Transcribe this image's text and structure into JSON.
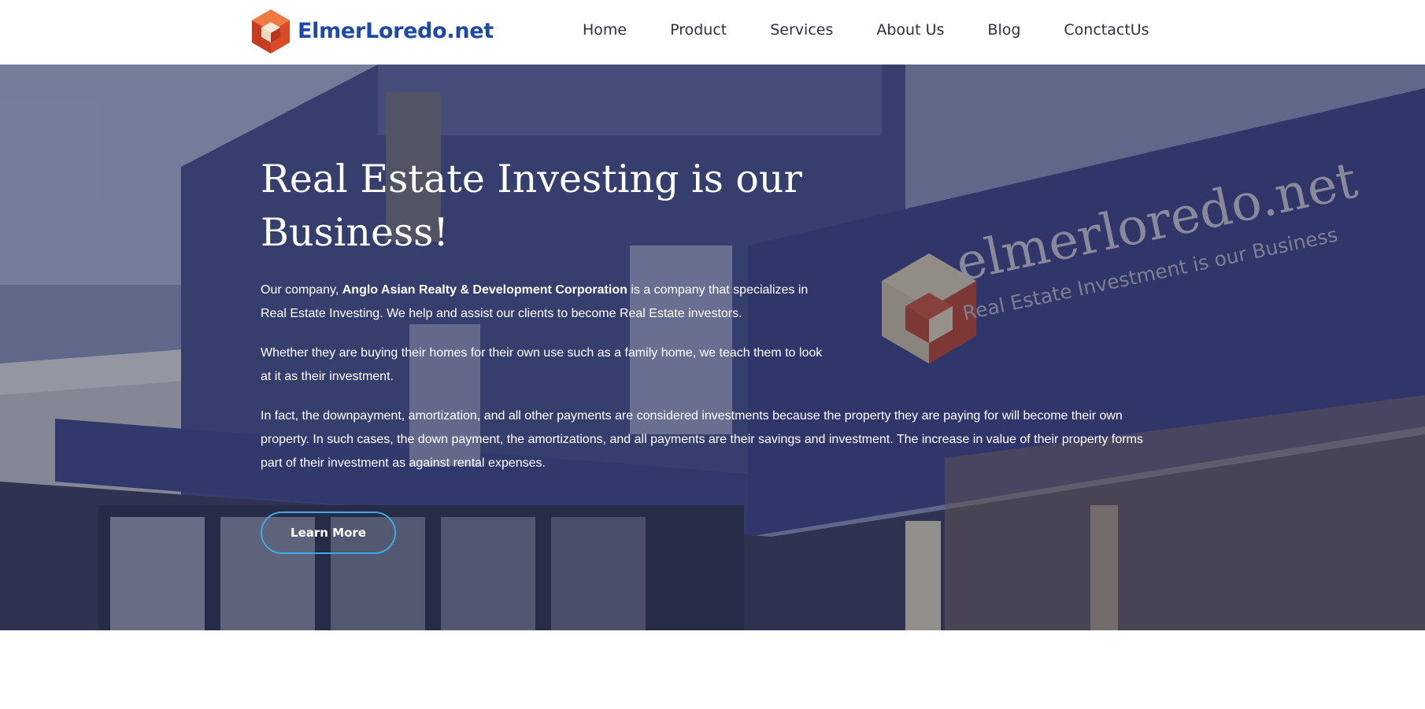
{
  "header": {
    "logo_text": "ElmerLoredo.net",
    "nav": [
      "Home",
      "Product",
      "Services",
      "About Us",
      "Blog",
      "ConctactUs"
    ]
  },
  "hero": {
    "title": "Real Estate Investing is our Business!",
    "p1_prefix": "Our company, ",
    "p1_company": "Anglo Asian Realty & Development Corporation",
    "p1_suffix": " is a company that specializes in Real Estate Investing. We help and assist our clients to become Real Estate investors.",
    "p2": "Whether they are buying their homes for their own use such as a family home, we teach them to look at it as their investment.",
    "p3": "In fact, the downpayment, amortization, and all other payments are considered investments because the property they are paying for will become their own property. In such cases, the down payment, the amortizations, and all payments are their savings and investment. The increase in value of their property forms part of their investment as against rental expenses.",
    "cta_label": "Learn More",
    "sign_line1": "elmerloredo.net",
    "sign_line2": "Real Estate Investment is our Business"
  },
  "colors": {
    "brand_blue": "#1d4aa8",
    "logo_orange": "#e2552f",
    "button_border": "#3ea9e6"
  }
}
